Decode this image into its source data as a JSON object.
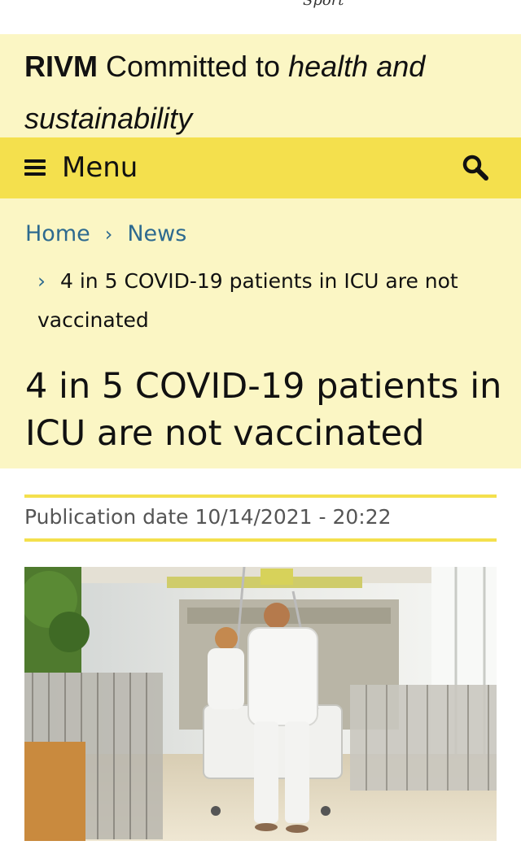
{
  "top": {
    "cut_text": "Sport"
  },
  "brand": {
    "name": "RIVM",
    "tagline_plain": "Committed to",
    "tagline_italic_1": "health and",
    "tagline_italic_2": "sustainability"
  },
  "menu": {
    "label": "Menu",
    "icon": "hamburger-icon",
    "search_icon": "search-icon"
  },
  "breadcrumb": {
    "items": [
      {
        "label": "Home"
      },
      {
        "label": "News"
      }
    ],
    "current": "4 in 5 COVID-19 patients in ICU are not vaccinated",
    "separator": "›"
  },
  "article": {
    "title": "4 in 5 COVID-19 patients in ICU are not vaccinated",
    "publication_date": "Publication date 10/14/2021 - 20:22",
    "image_alt": "Hospital staff wheeling a patient bed through a hospital corridor"
  },
  "colors": {
    "light_yellow": "#fbf6c4",
    "yellow": "#f4e04d",
    "link_blue": "#2d6a8f"
  }
}
